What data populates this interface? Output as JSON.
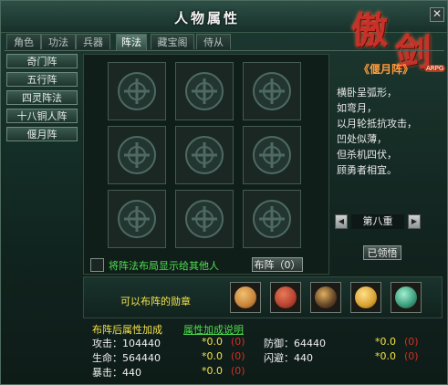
{
  "window": {
    "title": "人物属性",
    "close_glyph": "✕"
  },
  "logo": {
    "char1": "傲",
    "char2": "剑",
    "subtitle": "《偃月阵》",
    "badge": "ARPG"
  },
  "tabs": [
    {
      "label": "角色",
      "active": false
    },
    {
      "label": "功法",
      "active": false
    },
    {
      "label": "兵器",
      "active": false
    },
    {
      "label": "阵法",
      "active": true
    },
    {
      "label": "藏宝阁",
      "active": false
    },
    {
      "label": "侍从",
      "active": false
    }
  ],
  "formations": [
    "奇门阵",
    "五行阵",
    "四灵阵法",
    "十八铜人阵",
    "偃月阵"
  ],
  "grid": {
    "rows": 3,
    "cols": 3
  },
  "show_layout_checkbox": {
    "checked": false,
    "label": "将阵法布局显示给其他人"
  },
  "layout_button": "布阵（0）",
  "description": [
    "横卧呈弧形，",
    "如弯月，",
    "以月轮抵抗攻击，",
    "凹处似薄，",
    "但杀机四伏，",
    "顾勇者相宜。"
  ],
  "level": {
    "prev_icon": "triangle-left-icon",
    "text": "第八重",
    "next_icon": "triangle-right-icon"
  },
  "learned_button": "已领悟",
  "medals": {
    "label": "可以布阵的勋章",
    "items": [
      {
        "name": "lion-medal",
        "color": "#c8843a"
      },
      {
        "name": "red-seal-medal",
        "color": "#b5412e"
      },
      {
        "name": "dark-gem-medal",
        "color": "#6a4a2a"
      },
      {
        "name": "gold-coin-medal",
        "color": "#d9a030"
      },
      {
        "name": "jade-medal",
        "color": "#3a9a7a"
      }
    ]
  },
  "stats": {
    "header": "布阵后属性加成",
    "help_link": "属性加成说明",
    "left": [
      {
        "label": "攻击：104440",
        "bonus": "*0.0",
        "paren": "(0)"
      },
      {
        "label": "生命：564440",
        "bonus": "*0.0",
        "paren": "(0)"
      },
      {
        "label": "暴击：440",
        "bonus": "*0.0",
        "paren": "(0)"
      }
    ],
    "right": [
      {
        "label": "防御：64440",
        "bonus": "*0.0",
        "paren": "(0)"
      },
      {
        "label": "闪避：440",
        "bonus": "*0.0",
        "paren": "(0)"
      }
    ]
  },
  "colors": {
    "accent_yellow": "#f4e24a",
    "accent_green": "#4fe04f",
    "accent_red": "#d43020"
  }
}
